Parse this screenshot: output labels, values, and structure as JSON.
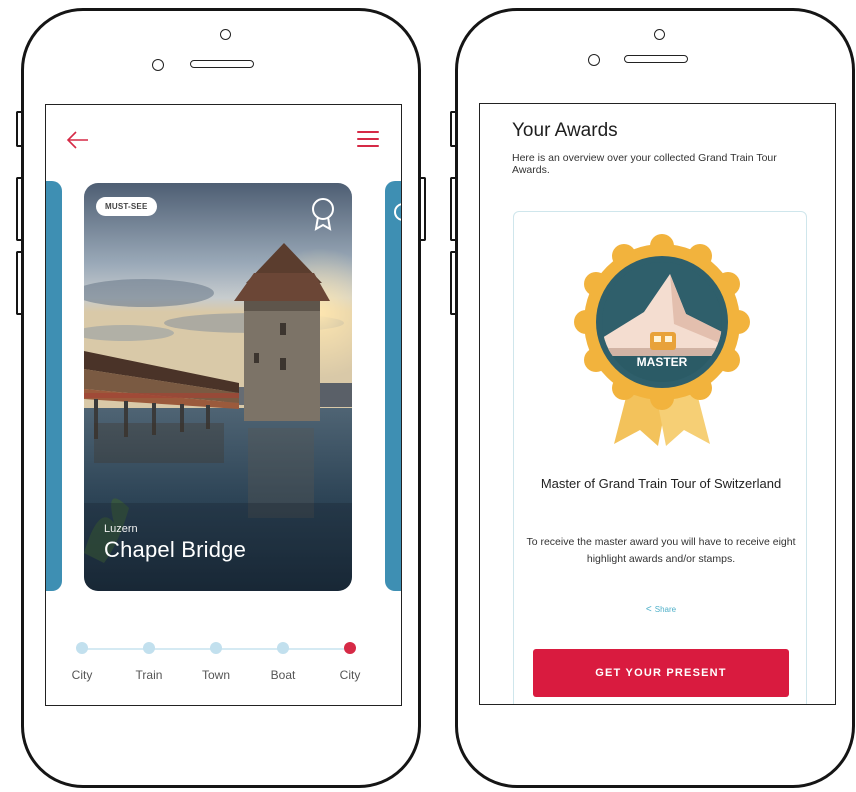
{
  "left_screen": {
    "card": {
      "badge": "MUST-SEE",
      "city": "Luzern",
      "title": "Chapel Bridge"
    },
    "timeline": [
      {
        "label": "City",
        "active": false
      },
      {
        "label": "Train",
        "active": false
      },
      {
        "label": "Town",
        "active": false
      },
      {
        "label": "Boat",
        "active": false
      },
      {
        "label": "City",
        "active": true
      }
    ]
  },
  "right_screen": {
    "title": "Your Awards",
    "description": "Here is an overview over your collected Grand Train Tour Awards.",
    "award": {
      "medal_label": "MASTER",
      "name": "Master of Grand Train Tour of Switzerland",
      "requirement": "To receive the master award you will have to receive eight highlight awards and/or stamps.",
      "share_label": "Share",
      "button_label": "GET YOUR PRESENT"
    }
  },
  "colors": {
    "accent_red": "#d91b3f",
    "teal": "#3e8fb3",
    "timeline_dot": "#c2e0ee",
    "medal_gold": "#f2b33d"
  },
  "icons": {
    "back": "back-arrow-icon",
    "menu": "hamburger-menu-icon",
    "award": "award-ribbon-icon",
    "share": "share-icon"
  }
}
